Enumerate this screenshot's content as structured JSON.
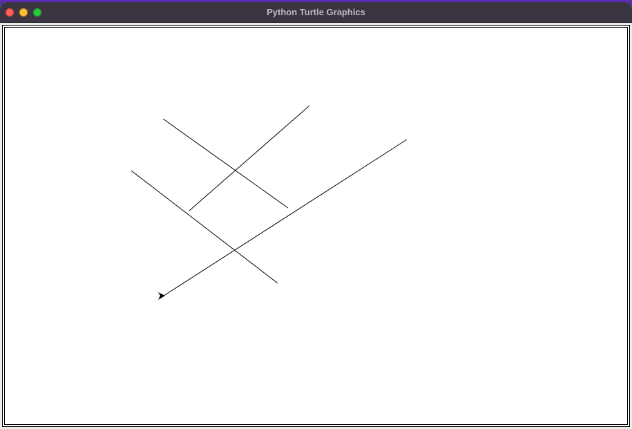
{
  "window": {
    "title": "Python Turtle Graphics",
    "controls": {
      "close_color": "#ff5f57",
      "minimize_color": "#febc2e",
      "zoom_color": "#28c840"
    }
  },
  "canvas": {
    "background": "#ffffff",
    "pen_color": "#000000"
  },
  "turtle": {
    "shape": "arrow-cursor-icon",
    "heading": "right"
  }
}
